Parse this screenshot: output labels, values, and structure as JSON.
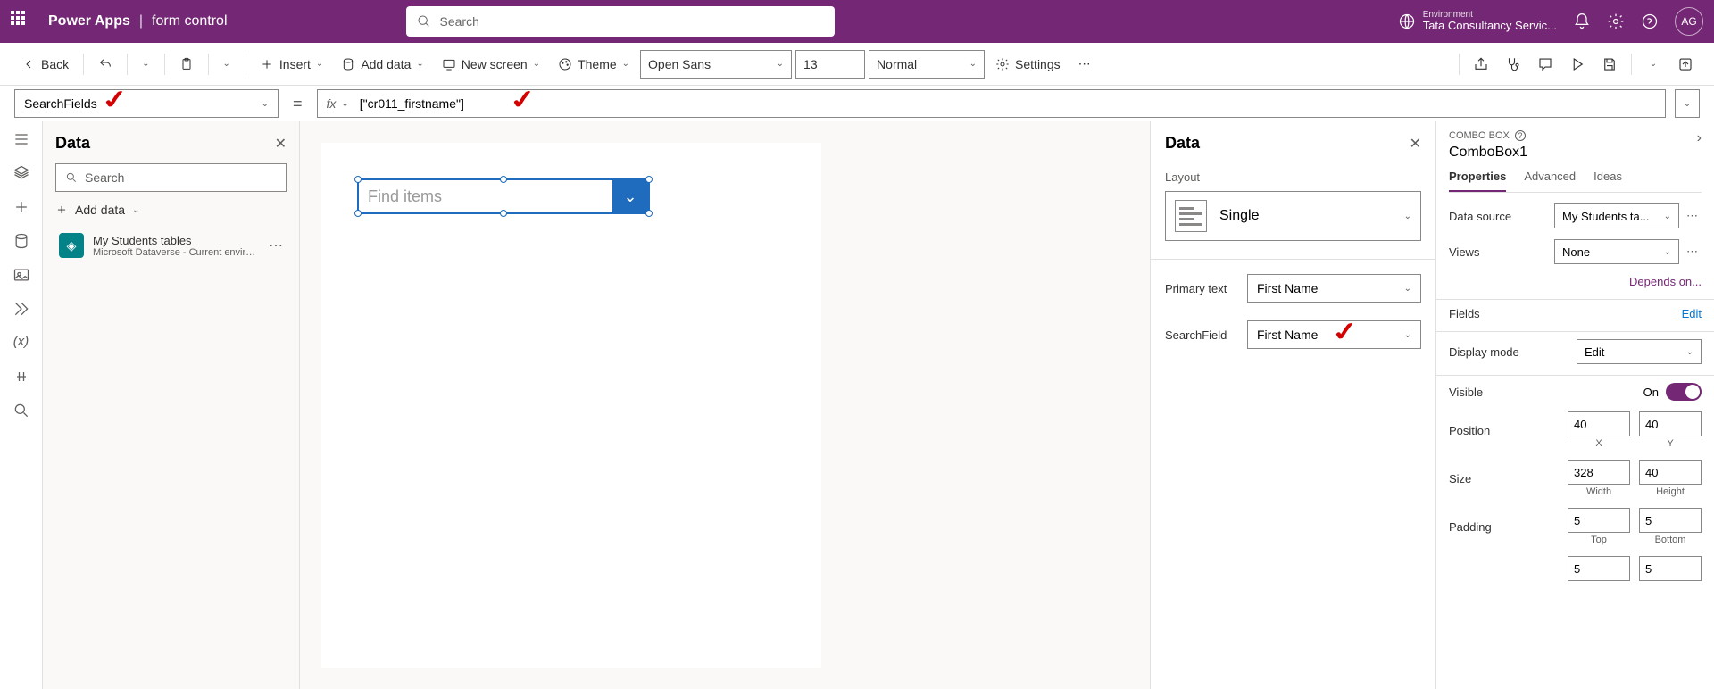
{
  "header": {
    "app": "Power Apps",
    "page": "form control",
    "search_placeholder": "Search",
    "env_label": "Environment",
    "env_name": "Tata Consultancy Servic...",
    "avatar": "AG"
  },
  "toolbar": {
    "back": "Back",
    "insert": "Insert",
    "add_data": "Add data",
    "new_screen": "New screen",
    "theme": "Theme",
    "font": "Open Sans",
    "font_size": "13",
    "font_weight": "Normal",
    "settings": "Settings"
  },
  "formula": {
    "property": "SearchFields",
    "expression": "[\"cr011_firstname\"]"
  },
  "left_panel": {
    "title": "Data",
    "search_placeholder": "Search",
    "add_data": "Add data",
    "source_name": "My Students tables",
    "source_sub": "Microsoft Dataverse - Current environm..."
  },
  "canvas": {
    "combo_placeholder": "Find items"
  },
  "right_data": {
    "title": "Data",
    "layout_label": "Layout",
    "layout_value": "Single",
    "primary_label": "Primary text",
    "primary_value": "First Name",
    "search_label": "SearchField",
    "search_value": "First Name"
  },
  "props": {
    "control_type": "COMBO BOX",
    "control_name": "ComboBox1",
    "tabs": {
      "properties": "Properties",
      "advanced": "Advanced",
      "ideas": "Ideas"
    },
    "data_source_label": "Data source",
    "data_source_value": "My Students ta...",
    "views_label": "Views",
    "views_value": "None",
    "depends": "Depends on...",
    "fields_label": "Fields",
    "fields_edit": "Edit",
    "display_mode_label": "Display mode",
    "display_mode_value": "Edit",
    "visible_label": "Visible",
    "visible_value": "On",
    "position_label": "Position",
    "pos_x": "40",
    "pos_y": "40",
    "x_label": "X",
    "y_label": "Y",
    "size_label": "Size",
    "width": "328",
    "height": "40",
    "width_label": "Width",
    "height_label": "Height",
    "padding_label": "Padding",
    "pad_top": "5",
    "pad_bottom": "5",
    "pad_left": "5",
    "pad_right": "5",
    "top_label": "Top",
    "bottom_label": "Bottom"
  }
}
